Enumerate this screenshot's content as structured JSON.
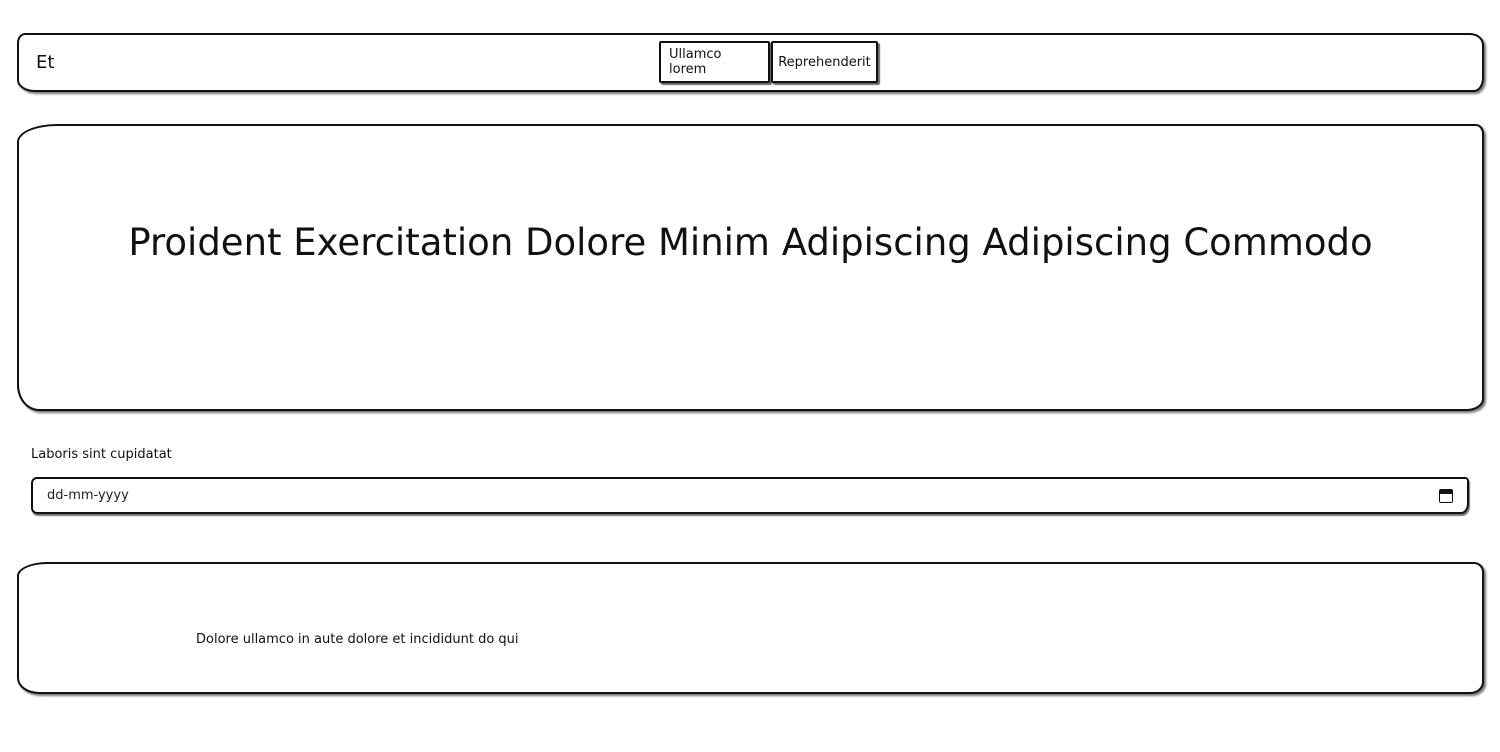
{
  "navbar": {
    "brand": "Et",
    "links": [
      "Ullamco lorem",
      "Reprehenderit"
    ]
  },
  "hero": {
    "title": "Proident Exercitation Dolore Minim Adipiscing Adipiscing Commodo"
  },
  "date_input": {
    "label": "Laboris sint cupidatat",
    "placeholder": "dd-mm-yyyy",
    "icon": "calendar-icon"
  },
  "footer": {
    "text": "Dolore ullamco in aute dolore et incididunt do qui"
  }
}
